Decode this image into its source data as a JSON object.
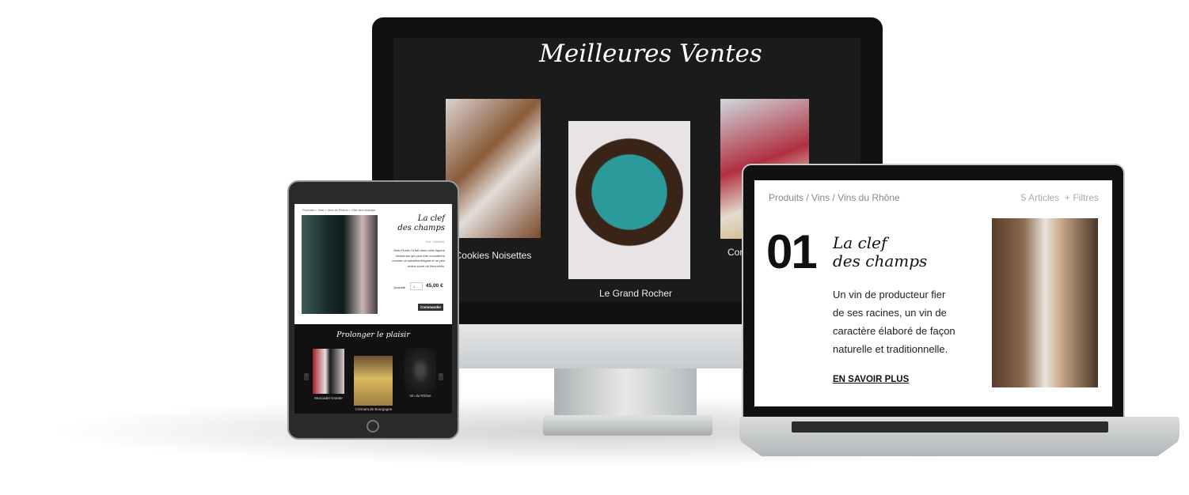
{
  "monitor": {
    "title": "Meilleures Ventes",
    "products": [
      {
        "label": "Cookies Noisettes"
      },
      {
        "label": "Le Grand Rocher"
      },
      {
        "label": "Con"
      }
    ]
  },
  "tablet": {
    "breadcrumb": "Produits > Vins > Vins du Rhône > Clef des champs",
    "title_line1": "La clef",
    "title_line2": "des champs",
    "ref": "Ref. 1006661",
    "description": "Niels Rodin l'a fait dans cette liqueur délicieuse qui peut être considérée comme un substitut élégant et un peu moins sucré du limoncello.",
    "quantity_label": "Quantité",
    "quantity_value": "1",
    "price": "45,00 €",
    "order_button": "Commander",
    "section_title": "Prolonger le plaisir",
    "related": [
      {
        "label": "Muscadet Granite"
      },
      {
        "label": "Crémant de Bourgogne"
      },
      {
        "label": "Vin du Rhône"
      }
    ]
  },
  "laptop": {
    "breadcrumb": [
      "Produits",
      "Vins",
      "Vins du Rhône"
    ],
    "articles": "5 Articles",
    "filters": "+ Filtres",
    "number": "01",
    "title_line1": "La clef",
    "title_line2": "des champs",
    "description": "Un vin de producteur fier de ses racines, un vin de caractère élaboré de façon naturelle et traditionnelle.",
    "cta": "EN SAVOIR PLUS"
  }
}
